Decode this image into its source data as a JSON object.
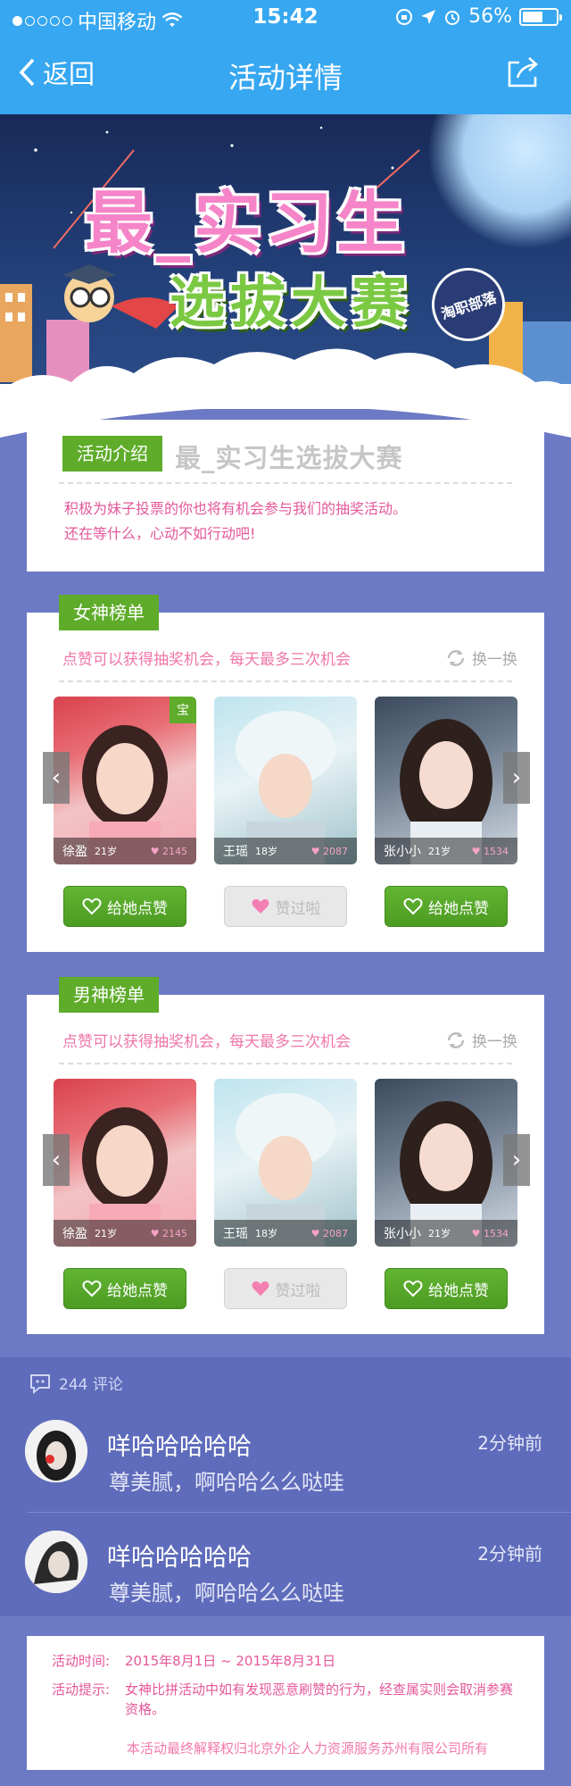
{
  "status_bar": {
    "carrier": "中国移动",
    "time": "15:42",
    "battery": "56%",
    "battery_level": 0.56
  },
  "nav": {
    "back_label": "返回",
    "title": "活动详情"
  },
  "banner": {
    "title": "最_实习生",
    "subtitle": "选拔大赛",
    "stamp": "淘职部落"
  },
  "intro": {
    "tag": "活动介绍",
    "title": "最_实习生选拔大赛",
    "lines": [
      "积极为妹子投票的你也将有机会参与我们的抽奖活动。",
      "还在等什么，心动不如行动吧!"
    ]
  },
  "female_board": {
    "tag": "女神榜单",
    "hint": "点赞可以获得抽奖机会，每天最多三次机会",
    "refresh": "换一换",
    "corner_badge": "宝",
    "people": [
      {
        "name": "徐盈",
        "age": "21岁",
        "likes": "2145",
        "button": "给她点赞",
        "liked": false
      },
      {
        "name": "王瑶",
        "age": "18岁",
        "likes": "2087",
        "button": "赞过啦",
        "liked": true
      },
      {
        "name": "张小小",
        "age": "21岁",
        "likes": "1534",
        "button": "给她点赞",
        "liked": false
      }
    ]
  },
  "male_board": {
    "tag": "男神榜单",
    "hint": "点赞可以获得抽奖机会，每天最多三次机会",
    "refresh": "换一换",
    "people": [
      {
        "name": "徐盈",
        "age": "21岁",
        "likes": "2145",
        "button": "给她点赞",
        "liked": false
      },
      {
        "name": "王瑶",
        "age": "18岁",
        "likes": "2087",
        "button": "赞过啦",
        "liked": true
      },
      {
        "name": "张小小",
        "age": "21岁",
        "likes": "1534",
        "button": "给她点赞",
        "liked": false
      }
    ]
  },
  "comments": {
    "count_label": "244 评论",
    "items": [
      {
        "name": "咩哈哈哈哈哈",
        "text": "尊美腻，啊哈哈么么哒哇",
        "time": "2分钟前"
      },
      {
        "name": "咩哈哈哈哈哈",
        "text": "尊美腻，啊哈哈么么哒哇",
        "time": "2分钟前"
      }
    ]
  },
  "footer": {
    "time_label": "活动时间:",
    "time_value": "2015年8月1日 ~ 2015年8月31日",
    "tip_label": "活动提示:",
    "tip_value": "女神比拼活动中如有发现恶意刷赞的行为，经查属实则会取消参赛资格。",
    "note": "本活动最终解释权归北京外企人力资源服务苏州有限公司所有"
  },
  "colors": {
    "nav_blue": "#36a7f0",
    "page_bg": "#6c79c4",
    "accent_green": "#5eac2a",
    "accent_pink": "#e4589a"
  }
}
